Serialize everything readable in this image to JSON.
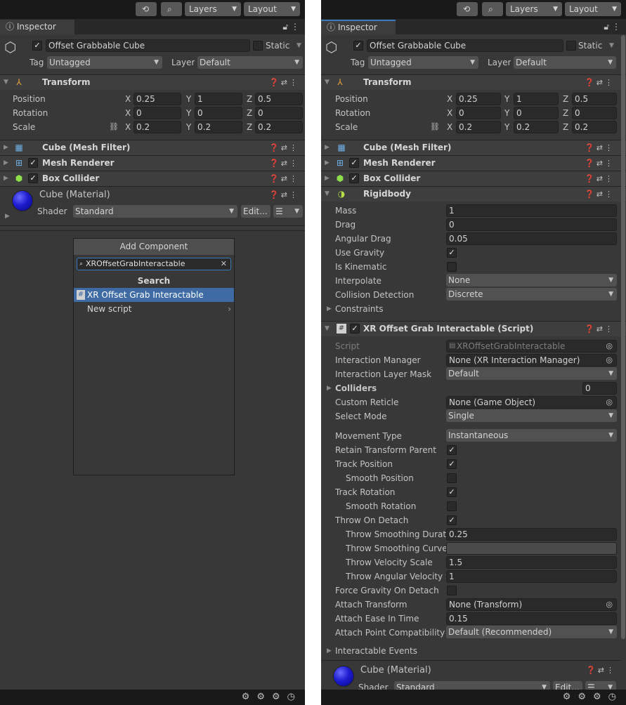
{
  "toolbar": {
    "history_icon": "history-icon",
    "search_icon": "search-icon",
    "layers_label": "Layers",
    "layout_label": "Layout"
  },
  "inspector": {
    "tab_label": "Inspector",
    "object_name": "Offset Grabbable Cube",
    "static_label": "Static",
    "tag_label": "Tag",
    "tag_value": "Untagged",
    "layer_label": "Layer",
    "layer_value": "Default"
  },
  "transform": {
    "title": "Transform",
    "position_label": "Position",
    "rotation_label": "Rotation",
    "scale_label": "Scale",
    "axes": [
      "X",
      "Y",
      "Z"
    ],
    "position": [
      "0.25",
      "1",
      "0.5"
    ],
    "rotation": [
      "0",
      "0",
      "0"
    ],
    "scale": [
      "0.2",
      "0.2",
      "0.2"
    ]
  },
  "components": {
    "mesh_filter": "Cube (Mesh Filter)",
    "mesh_renderer": "Mesh Renderer",
    "box_collider": "Box Collider",
    "rigidbody": "Rigidbody"
  },
  "material": {
    "name": "Cube (Material)",
    "shader_label": "Shader",
    "shader_value": "Standard",
    "edit_label": "Edit..."
  },
  "add_component": {
    "title": "Add Component",
    "search_value": "XROffsetGrabInteractable",
    "section": "Search",
    "result": "XR Offset Grab Interactable",
    "new_script": "New script"
  },
  "rigidbody": {
    "mass_label": "Mass",
    "mass": "1",
    "drag_label": "Drag",
    "drag": "0",
    "angular_drag_label": "Angular Drag",
    "angular_drag": "0.05",
    "use_gravity_label": "Use Gravity",
    "is_kinematic_label": "Is Kinematic",
    "interpolate_label": "Interpolate",
    "interpolate": "None",
    "collision_label": "Collision Detection",
    "collision": "Discrete",
    "constraints_label": "Constraints"
  },
  "xr_script": {
    "title": "XR Offset Grab Interactable (Script)",
    "script_label": "Script",
    "script": "XROffsetGrabInteractable",
    "interaction_manager_label": "Interaction Manager",
    "interaction_manager": "None (XR Interaction Manager)",
    "layer_mask_label": "Interaction Layer Mask",
    "layer_mask": "Default",
    "colliders_label": "Colliders",
    "colliders": "0",
    "custom_reticle_label": "Custom Reticle",
    "custom_reticle": "None (Game Object)",
    "select_mode_label": "Select Mode",
    "select_mode": "Single",
    "movement_type_label": "Movement Type",
    "movement_type": "Instantaneous",
    "retain_parent_label": "Retain Transform Parent",
    "track_position_label": "Track Position",
    "smooth_position_label": "Smooth Position",
    "track_rotation_label": "Track Rotation",
    "smooth_rotation_label": "Smooth Rotation",
    "throw_on_detach_label": "Throw On Detach",
    "throw_duration_label": "Throw Smoothing Duratic",
    "throw_duration": "0.25",
    "throw_curve_label": "Throw Smoothing Curve",
    "throw_velocity_label": "Throw Velocity Scale",
    "throw_velocity": "1.5",
    "throw_angular_label": "Throw Angular Velocity S",
    "throw_angular": "1",
    "force_gravity_label": "Force Gravity On Detach",
    "attach_transform_label": "Attach Transform",
    "attach_transform": "None (Transform)",
    "attach_ease_label": "Attach Ease In Time",
    "attach_ease": "0.15",
    "attach_compat_label": "Attach Point Compatibility M",
    "attach_compat": "Default (Recommended)",
    "events_label": "Interactable Events"
  },
  "colors": {
    "accent": "#3a79bb",
    "selected_row": "#3e6ba3",
    "panel": "#383838",
    "field": "#2a2a2a"
  }
}
